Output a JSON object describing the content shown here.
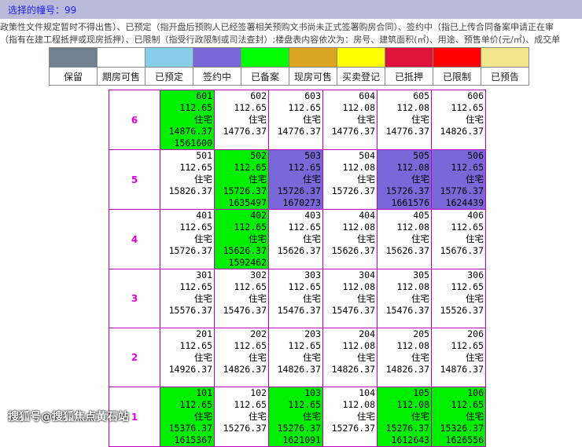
{
  "header": {
    "selected_building": "选择的幢号：99"
  },
  "notes": [
    "政策性文件规定暂时不得出售）、已预定（指开盘后预购人已经签署相关预购文书尚未正式签署购房合同）、签约中（指已上传合同备案申请正在审",
    "（指有在建工程抵押或现房抵押）、已限制（指受行政限制或司法查封）;楼盘表内容依次为：房号、建筑面积(㎡)、用途、预售单价(元/㎡)、成交单"
  ],
  "legend": [
    {
      "label": "保留",
      "color": "#708090"
    },
    {
      "label": "期房可售",
      "color": "#ffffff"
    },
    {
      "label": "已预定",
      "color": "#87ceeb"
    },
    {
      "label": "签约中",
      "color": "#7b68d8"
    },
    {
      "label": "已备案",
      "color": "#00ff00"
    },
    {
      "label": "现房可售",
      "color": "#daa520"
    },
    {
      "label": "买卖登记",
      "color": "#ffff00"
    },
    {
      "label": "已抵押",
      "color": "#dc143c"
    },
    {
      "label": "已限制",
      "color": "#ff0000"
    },
    {
      "label": "已预告",
      "color": "#f0e68c"
    }
  ],
  "floors": [
    {
      "floor": "6",
      "units": [
        {
          "room": "601",
          "area": "112.65",
          "use": "住宅",
          "price": "14876.37",
          "deal": "1561600",
          "status": "green"
        },
        {
          "room": "602",
          "area": "112.65",
          "use": "住宅",
          "price": "14776.37",
          "deal": "",
          "status": "white"
        },
        {
          "room": "603",
          "area": "112.65",
          "use": "住宅",
          "price": "14776.37",
          "deal": "",
          "status": "white"
        },
        {
          "room": "604",
          "area": "112.08",
          "use": "住宅",
          "price": "14776.37",
          "deal": "",
          "status": "white"
        },
        {
          "room": "605",
          "area": "112.08",
          "use": "住宅",
          "price": "14776.37",
          "deal": "",
          "status": "white"
        },
        {
          "room": "606",
          "area": "112.65",
          "use": "住宅",
          "price": "14826.37",
          "deal": "",
          "status": "white"
        }
      ]
    },
    {
      "floor": "5",
      "units": [
        {
          "room": "501",
          "area": "112.65",
          "use": "住宅",
          "price": "15826.37",
          "deal": "",
          "status": "white"
        },
        {
          "room": "502",
          "area": "112.65",
          "use": "住宅",
          "price": "15726.37",
          "deal": "1635497",
          "status": "green"
        },
        {
          "room": "503",
          "area": "112.65",
          "use": "住宅",
          "price": "15726.37",
          "deal": "1670273",
          "status": "purple"
        },
        {
          "room": "504",
          "area": "112.08",
          "use": "住宅",
          "price": "15726.37",
          "deal": "",
          "status": "white"
        },
        {
          "room": "505",
          "area": "112.08",
          "use": "住宅",
          "price": "15726.37",
          "deal": "1661576",
          "status": "purple"
        },
        {
          "room": "506",
          "area": "112.65",
          "use": "住宅",
          "price": "15776.37",
          "deal": "1624439",
          "status": "purple"
        }
      ]
    },
    {
      "floor": "4",
      "units": [
        {
          "room": "401",
          "area": "112.65",
          "use": "住宅",
          "price": "15726.37",
          "deal": "",
          "status": "white"
        },
        {
          "room": "402",
          "area": "112.65",
          "use": "住宅",
          "price": "15626.37",
          "deal": "1592462",
          "status": "green"
        },
        {
          "room": "403",
          "area": "112.65",
          "use": "住宅",
          "price": "15626.37",
          "deal": "",
          "status": "white"
        },
        {
          "room": "404",
          "area": "112.08",
          "use": "住宅",
          "price": "15626.37",
          "deal": "",
          "status": "white"
        },
        {
          "room": "405",
          "area": "112.08",
          "use": "住宅",
          "price": "15626.37",
          "deal": "",
          "status": "white"
        },
        {
          "room": "406",
          "area": "112.65",
          "use": "住宅",
          "price": "15676.37",
          "deal": "",
          "status": "white"
        }
      ]
    },
    {
      "floor": "3",
      "units": [
        {
          "room": "301",
          "area": "112.65",
          "use": "住宅",
          "price": "15576.37",
          "deal": "",
          "status": "white"
        },
        {
          "room": "302",
          "area": "112.65",
          "use": "住宅",
          "price": "15476.37",
          "deal": "",
          "status": "white"
        },
        {
          "room": "303",
          "area": "112.65",
          "use": "住宅",
          "price": "15476.37",
          "deal": "",
          "status": "white"
        },
        {
          "room": "304",
          "area": "112.08",
          "use": "住宅",
          "price": "15476.37",
          "deal": "",
          "status": "white"
        },
        {
          "room": "305",
          "area": "112.08",
          "use": "住宅",
          "price": "15476.37",
          "deal": "",
          "status": "white"
        },
        {
          "room": "306",
          "area": "112.65",
          "use": "住宅",
          "price": "15526.37",
          "deal": "",
          "status": "white"
        }
      ]
    },
    {
      "floor": "2",
      "units": [
        {
          "room": "201",
          "area": "112.65",
          "use": "住宅",
          "price": "14926.37",
          "deal": "",
          "status": "white"
        },
        {
          "room": "202",
          "area": "112.65",
          "use": "住宅",
          "price": "14826.37",
          "deal": "",
          "status": "white"
        },
        {
          "room": "203",
          "area": "112.65",
          "use": "住宅",
          "price": "14826.37",
          "deal": "",
          "status": "white"
        },
        {
          "room": "204",
          "area": "112.08",
          "use": "住宅",
          "price": "14826.37",
          "deal": "",
          "status": "white"
        },
        {
          "room": "205",
          "area": "112.08",
          "use": "住宅",
          "price": "14826.37",
          "deal": "",
          "status": "white"
        },
        {
          "room": "206",
          "area": "112.65",
          "use": "住宅",
          "price": "14876.37",
          "deal": "",
          "status": "white"
        }
      ]
    },
    {
      "floor": "1",
      "units": [
        {
          "room": "101",
          "area": "112.65",
          "use": "住宅",
          "price": "15376.37",
          "deal": "1615367",
          "status": "green"
        },
        {
          "room": "102",
          "area": "112.65",
          "use": "住宅",
          "price": "15276.37",
          "deal": "",
          "status": "white"
        },
        {
          "room": "103",
          "area": "112.65",
          "use": "住宅",
          "price": "15276.37",
          "deal": "1621091",
          "status": "green"
        },
        {
          "room": "104",
          "area": "112.08",
          "use": "住宅",
          "price": "15276.37",
          "deal": "",
          "status": "white"
        },
        {
          "room": "105",
          "area": "112.08",
          "use": "住宅",
          "price": "15276.37",
          "deal": "1612643",
          "status": "green"
        },
        {
          "room": "106",
          "area": "112.65",
          "use": "住宅",
          "price": "15326.37",
          "deal": "1626556",
          "status": "green"
        }
      ]
    }
  ],
  "watermark": "搜狐号@搜狐焦点黄石站"
}
